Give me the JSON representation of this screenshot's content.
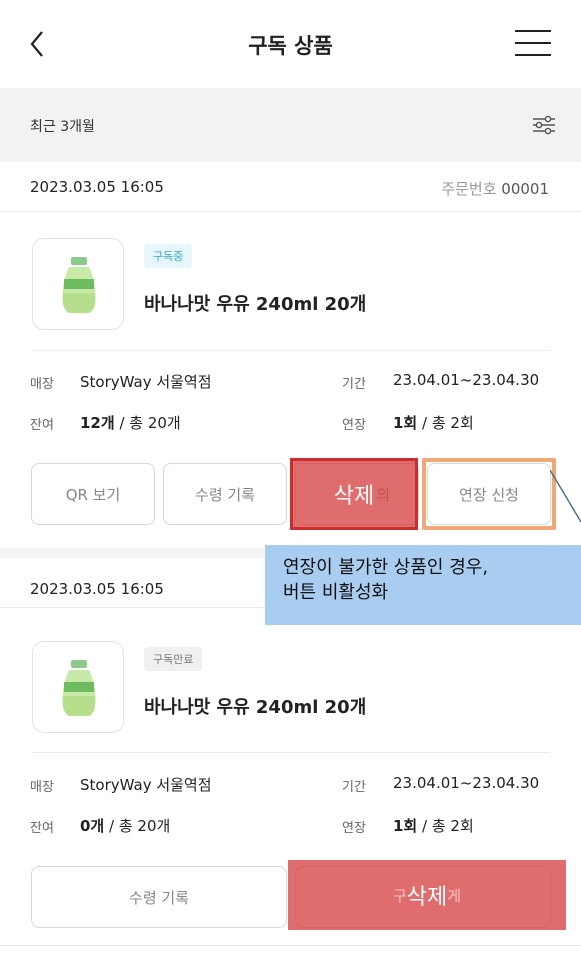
{
  "header": {
    "title": "구독 상품"
  },
  "filter": {
    "label": "최근 3개월"
  },
  "orders": [
    {
      "date": "2023.03.05 16:05",
      "order_no_label": "주문번호",
      "order_no": "00001",
      "badge": "구독중",
      "product": "바나나맛 우유 240ml 20개",
      "store_label": "매장",
      "store": "StoryWay 서울역점",
      "period_label": "기간",
      "period": "23.04.01~23.04.30",
      "remain_label": "잔여",
      "remain_count": "12개",
      "remain_total": " / 총 20개",
      "extend_label": "연장",
      "extend_count": "1회",
      "extend_total": " / 총 2회",
      "buttons": {
        "qr": "QR 보기",
        "history": "수령 기록",
        "inquiry_partial": "의",
        "extend": "연장 신청"
      },
      "overlay_label": "삭제"
    },
    {
      "date": "2023.03.05 16:05",
      "badge": "구독만료",
      "product": "바나나맛 우유 240ml 20개",
      "store_label": "매장",
      "store": "StoryWay 서울역점",
      "period_label": "기간",
      "period": "23.04.01~23.04.30",
      "remain_label": "잔여",
      "remain_count": "0개",
      "remain_total": " / 총 20개",
      "extend_label": "연장",
      "extend_count": "1회",
      "extend_total": " / 총 2회",
      "buttons": {
        "history": "수령 기록",
        "partial_left": "구",
        "partial_right": "게"
      },
      "overlay_label": "삭제"
    }
  ],
  "callout": {
    "line1": "연장이 불가한 상품인 경우,",
    "line2": "버튼 비활성화"
  },
  "colors": {
    "accent_overlay": "#d63c3c",
    "annotation_box": "#f0a878",
    "callout_bg": "#a9cdf0",
    "badge_active": "#3aa6c8"
  },
  "icons": [
    "back-icon",
    "hamburger-menu-icon",
    "filter-sliders-icon",
    "banana-milk-bottle-icon"
  ]
}
